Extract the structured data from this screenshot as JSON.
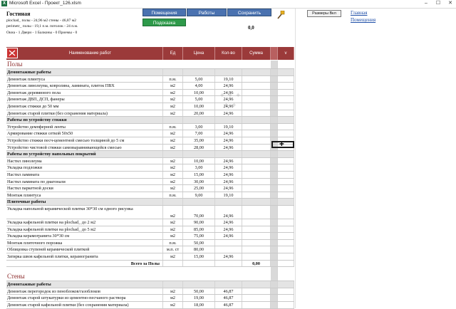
{
  "window": {
    "title": "Microsoft Excel - Проект_126.xlsm",
    "minimize": "–",
    "maximize": "☐",
    "close": "✕"
  },
  "header": {
    "room": "Гостиная",
    "line1": "plochad_   полы -  24,96 м2    стены - 46,87 м2",
    "line2": "perimetr_  полы - 19,1 п.м.  потолок - 24 п.м.",
    "line3": "Окна - 1   Двери - 1   Балконы - 0   Проемы - 0",
    "total": "0,0"
  },
  "buttons": {
    "rooms": "Помещения",
    "works": "Работы",
    "save": "Сохранить",
    "hint": "Подсказка"
  },
  "right_pane": {
    "sizes_button": "Размеры Вкл",
    "link_main": "Главная",
    "link_rooms": "Помещения"
  },
  "table": {
    "headers": {
      "name": "Наименование работ",
      "unit": "Ед",
      "price": "Цена",
      "qty": "Кол-во",
      "sum": "Сумма",
      "v": "v"
    },
    "rows": [
      {
        "type": "section",
        "name": "Полы"
      },
      {
        "type": "group",
        "name": "Демонтажные работы"
      },
      {
        "name": "Демонтаж плинтуса",
        "unit": "п.м.",
        "price": "5,00",
        "qty": "19,10"
      },
      {
        "name": "Демонтаж линолеума, ковролина, ламината, плиток ПВХ",
        "unit": "м2",
        "price": "4,00",
        "qty": "24,96"
      },
      {
        "name": "Демонтаж деревянного пола",
        "unit": "м2",
        "price": "10,00",
        "qty": "24,96"
      },
      {
        "name": "Демонтаж ДВП, ДСП, фанеры",
        "unit": "м2",
        "price": "5,00",
        "qty": "24,96"
      },
      {
        "name": "Демонтаж стяжки до 50 мм",
        "unit": "м2",
        "price": "10,00",
        "qty": "24,96"
      },
      {
        "name": "Демонтаж старой плитки (без сохранения материала)",
        "unit": "м2",
        "price": "20,00",
        "qty": "24,96"
      },
      {
        "type": "group",
        "name": "Работы по устройству стяжки"
      },
      {
        "name": "Устройство демпферной ленты",
        "unit": "п.м.",
        "price": "3,00",
        "qty": "19,10"
      },
      {
        "name": "Армирование стяжки сеткой 50х50",
        "unit": "м2",
        "price": "7,00",
        "qty": "24,96"
      },
      {
        "name": "Устройство стяжки песч-цементной смесью толщиной до 5 см",
        "unit": "м2",
        "price": "35,00",
        "qty": "24,96"
      },
      {
        "name": "Устройство чистовой стяжки самовыравнивающейся смесью",
        "unit": "м2",
        "price": "28,00",
        "qty": "24,96"
      },
      {
        "type": "group",
        "name": "Работы по устройству напольных покрытий"
      },
      {
        "name": "Настил линолеума",
        "unit": "м2",
        "price": "10,00",
        "qty": "24,96"
      },
      {
        "name": "Укладка подложки",
        "unit": "м2",
        "price": "3,00",
        "qty": "24,96"
      },
      {
        "name": "Настил ламината",
        "unit": "м2",
        "price": "15,00",
        "qty": "24,96"
      },
      {
        "name": "Настил ламината по диагонали",
        "unit": "м2",
        "price": "30,00",
        "qty": "24,96"
      },
      {
        "name": "Настил паркетной доски",
        "unit": "м2",
        "price": "25,00",
        "qty": "24,96"
      },
      {
        "name": "Монтаж плинтуса",
        "unit": "п.м.",
        "price": "9,00",
        "qty": "19,10"
      },
      {
        "type": "group",
        "name": "Плиточные работы"
      },
      {
        "type": "tall",
        "name": "Укладка напольной керамической плитки 30*30 см одного рисунка",
        "unit": "м2",
        "price": "70,00",
        "qty": "24,96"
      },
      {
        "name": "Укладка кафельной плитки на plochad_ до 2 м2",
        "unit": "м2",
        "price": "90,00",
        "qty": "24,96"
      },
      {
        "name": "Укладка кафельной плитки на plochad_ до 5 м2",
        "unit": "м2",
        "price": "85,00",
        "qty": "24,96"
      },
      {
        "name": "Укладка керамогранита 30*30 см",
        "unit": "м2",
        "price": "75,00",
        "qty": "24,96"
      },
      {
        "name": "Монтаж плиточного порожка",
        "unit": "п.м.",
        "price": "50,00",
        "qty": ""
      },
      {
        "name": "Облицовка ступеней керамической плиткой",
        "unit": "м.п. ст",
        "price": "80,00",
        "qty": ""
      },
      {
        "name": "Затирка швов кафельной плитки, керамогранита",
        "unit": "м2",
        "price": "15,00",
        "qty": "24,96"
      },
      {
        "type": "total",
        "name": "Всего за Полы",
        "sum": "0,00"
      },
      {
        "type": "blank",
        "name": ""
      },
      {
        "type": "section",
        "name": "Стены"
      },
      {
        "type": "group",
        "name": "Демонтажные работы"
      },
      {
        "name": "Демонтаж перегородок из пеноблоков/газоблоков",
        "unit": "м2",
        "price": "50,00",
        "qty": "46,87"
      },
      {
        "name": "Демонтаж старой штукатурки из цементно-песчаного раствора",
        "unit": "м2",
        "price": "19,00",
        "qty": "46,87"
      },
      {
        "name": "Демонтаж старой кафельной плитки (без сохранения материала)",
        "unit": "м2",
        "price": "18,00",
        "qty": "46,87"
      }
    ]
  }
}
